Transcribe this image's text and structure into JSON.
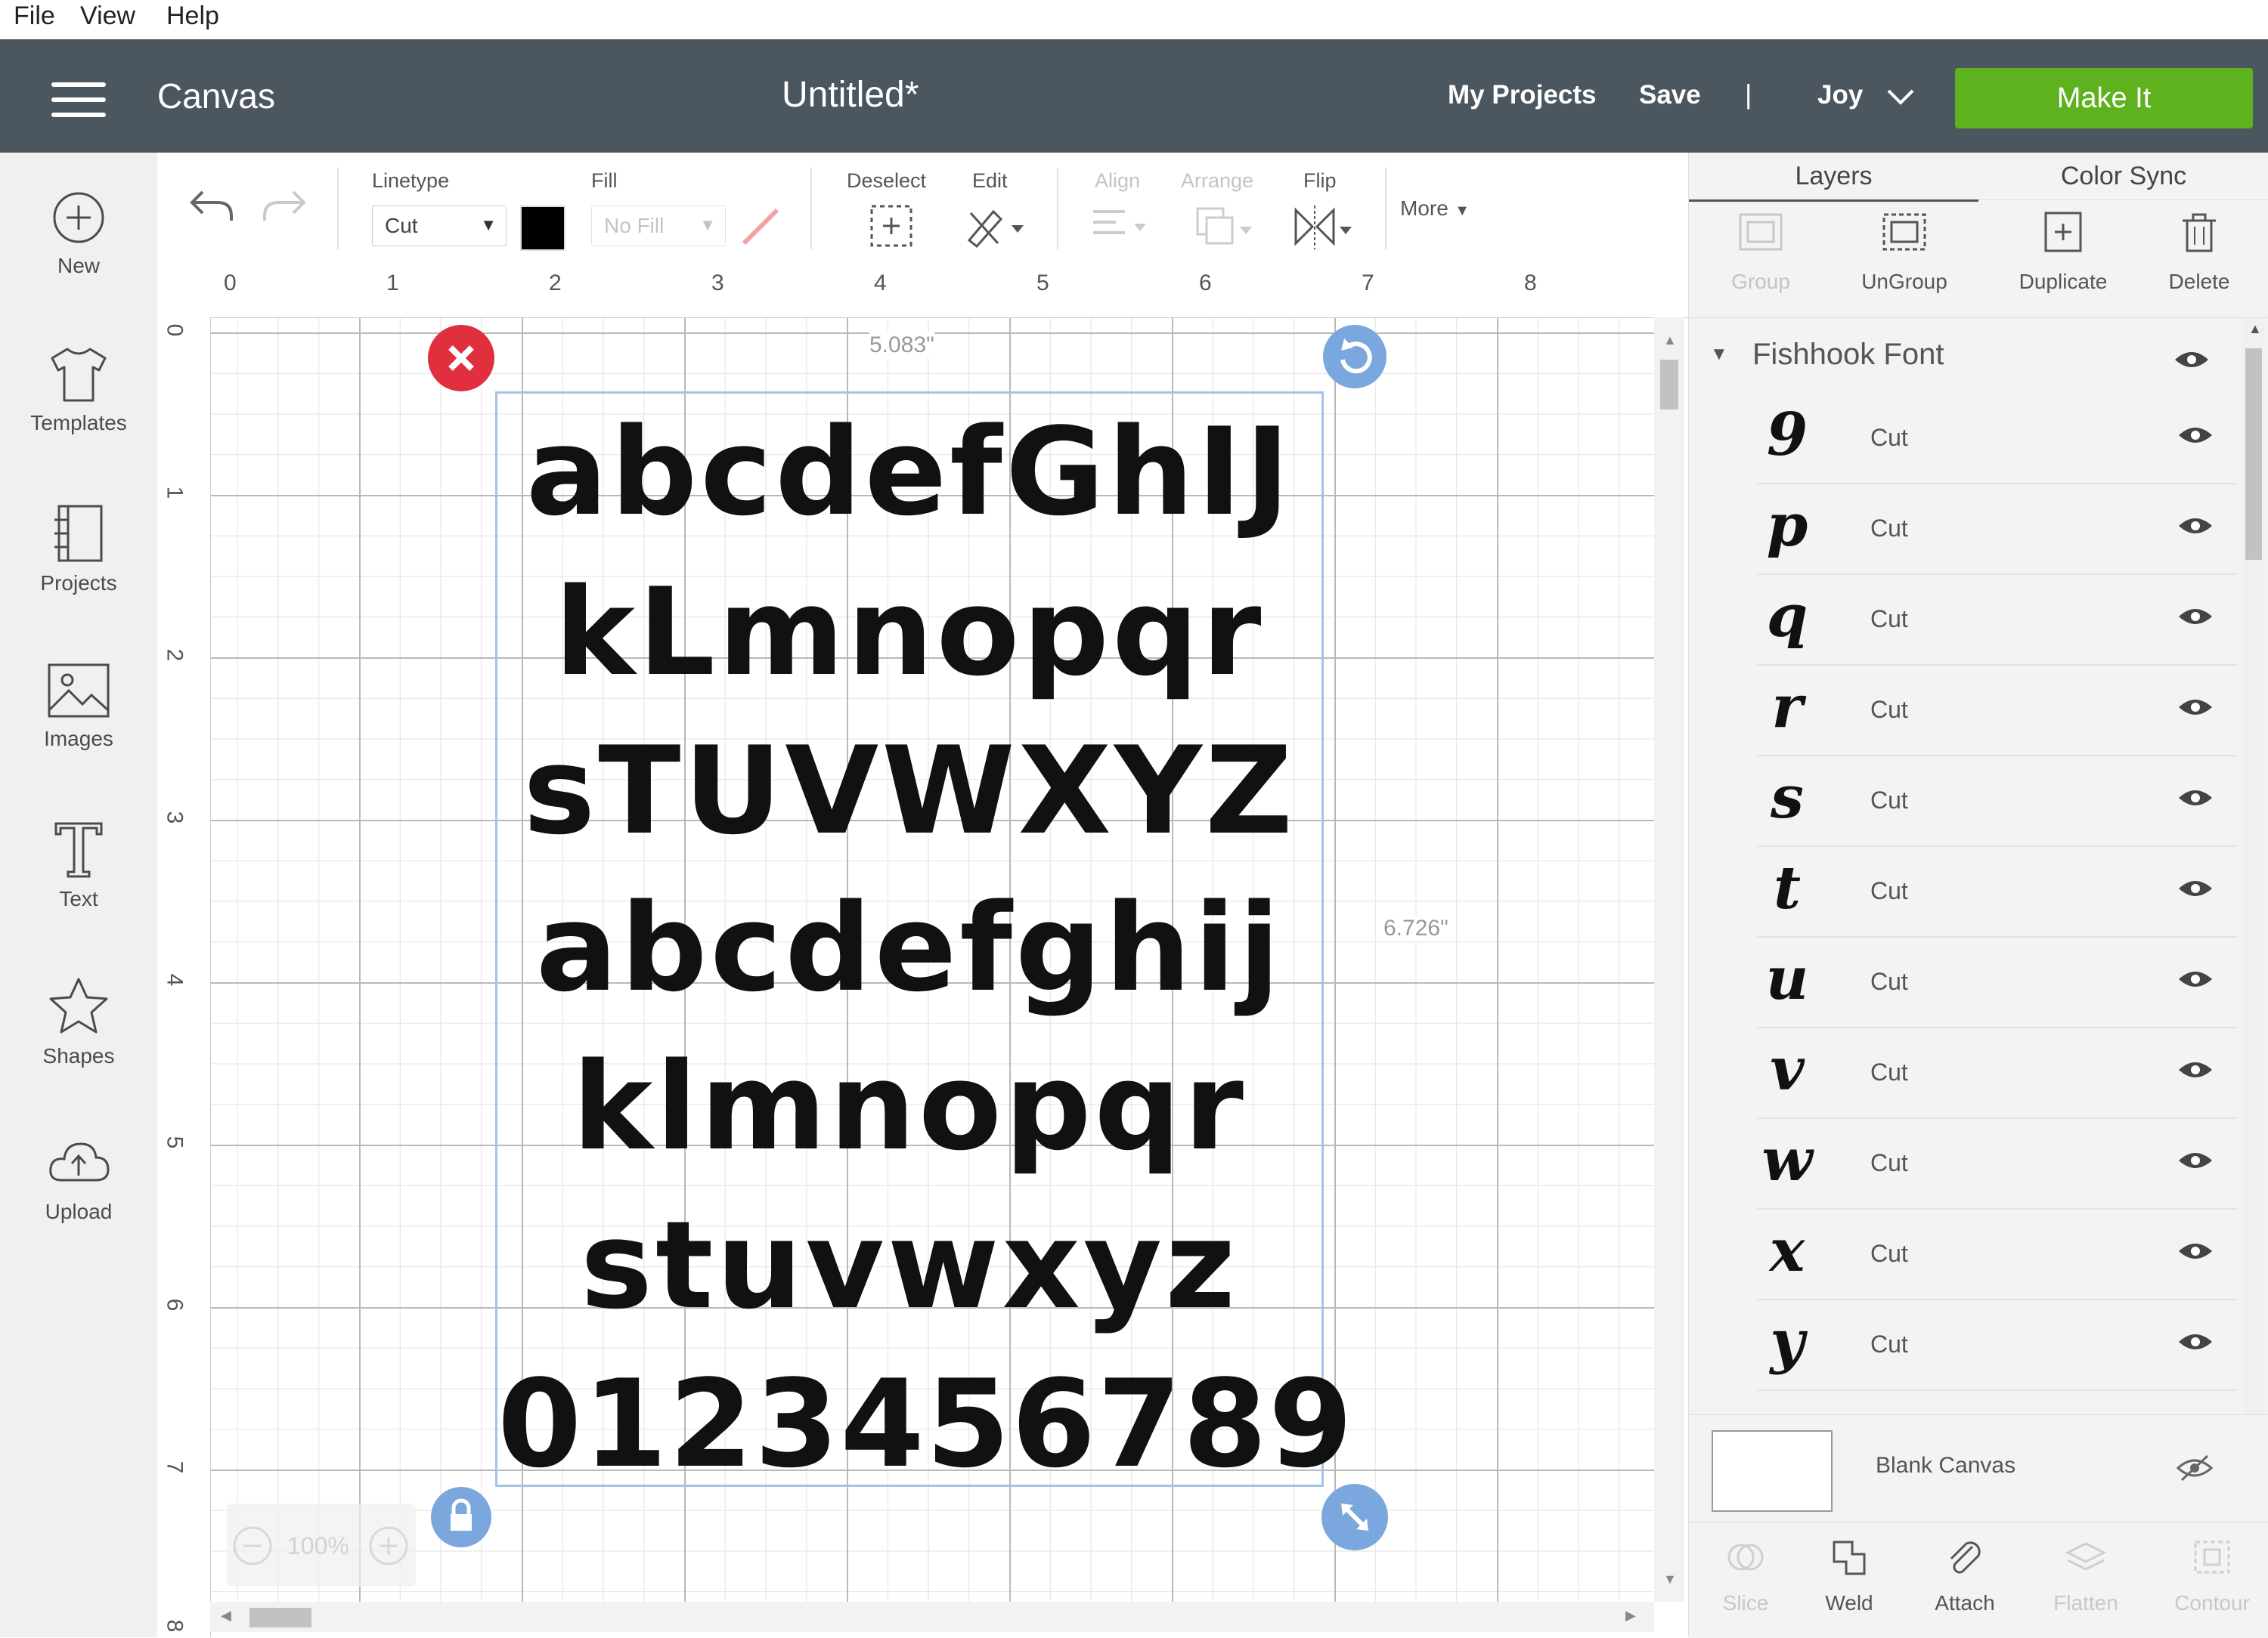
{
  "menu": {
    "file": "File",
    "view": "View",
    "help": "Help"
  },
  "header": {
    "app_title": "Canvas",
    "doc_title": "Untitled*",
    "my_projects": "My Projects",
    "save": "Save",
    "divider": "|",
    "machine": "Joy",
    "make_it": "Make It",
    "make_it_color": "#5db21e"
  },
  "sidebar": {
    "items": [
      {
        "label": "New",
        "icon": "plus-circle-icon"
      },
      {
        "label": "Templates",
        "icon": "shirt-icon"
      },
      {
        "label": "Projects",
        "icon": "projects-icon"
      },
      {
        "label": "Images",
        "icon": "image-icon"
      },
      {
        "label": "Text",
        "icon": "text-icon"
      },
      {
        "label": "Shapes",
        "icon": "shapes-icon"
      },
      {
        "label": "Upload",
        "icon": "upload-cloud-icon"
      }
    ]
  },
  "toolbar": {
    "linetype_label": "Linetype",
    "linetype_value": "Cut",
    "fill_label": "Fill",
    "fill_value": "No Fill",
    "deselect": "Deselect",
    "edit": "Edit",
    "align": "Align",
    "arrange": "Arrange",
    "flip": "Flip",
    "more": "More"
  },
  "rulers": {
    "top": [
      "0",
      "1",
      "2",
      "3",
      "4",
      "5",
      "6",
      "7",
      "8"
    ],
    "left": [
      "0",
      "1",
      "2",
      "3",
      "4",
      "5",
      "6",
      "7",
      "8"
    ]
  },
  "selection": {
    "width": "5.083\"",
    "height": "6.726\""
  },
  "canvas_text": {
    "lines": [
      "abcdefGhIJ",
      "kLmnopqr",
      "sTUVWXYZ",
      "abcdefghij",
      "klmnopqr",
      "stuvwxyz",
      "0123456789"
    ]
  },
  "zoom": {
    "level": "100%"
  },
  "right_panel": {
    "tabs": {
      "layers": "Layers",
      "color_sync": "Color Sync"
    },
    "actions": {
      "group": "Group",
      "ungroup": "UnGroup",
      "duplicate": "Duplicate",
      "delete": "Delete"
    },
    "group_name": "Fishhook Font",
    "layers": [
      {
        "glyph": "9",
        "op": "Cut"
      },
      {
        "glyph": "p",
        "op": "Cut"
      },
      {
        "glyph": "q",
        "op": "Cut"
      },
      {
        "glyph": "r",
        "op": "Cut"
      },
      {
        "glyph": "s",
        "op": "Cut"
      },
      {
        "glyph": "t",
        "op": "Cut"
      },
      {
        "glyph": "u",
        "op": "Cut"
      },
      {
        "glyph": "v",
        "op": "Cut"
      },
      {
        "glyph": "w",
        "op": "Cut"
      },
      {
        "glyph": "x",
        "op": "Cut"
      },
      {
        "glyph": "y",
        "op": "Cut"
      }
    ],
    "blank_canvas": "Blank Canvas",
    "bottom": {
      "slice": "Slice",
      "weld": "Weld",
      "attach": "Attach",
      "flatten": "Flatten",
      "contour": "Contour"
    }
  }
}
